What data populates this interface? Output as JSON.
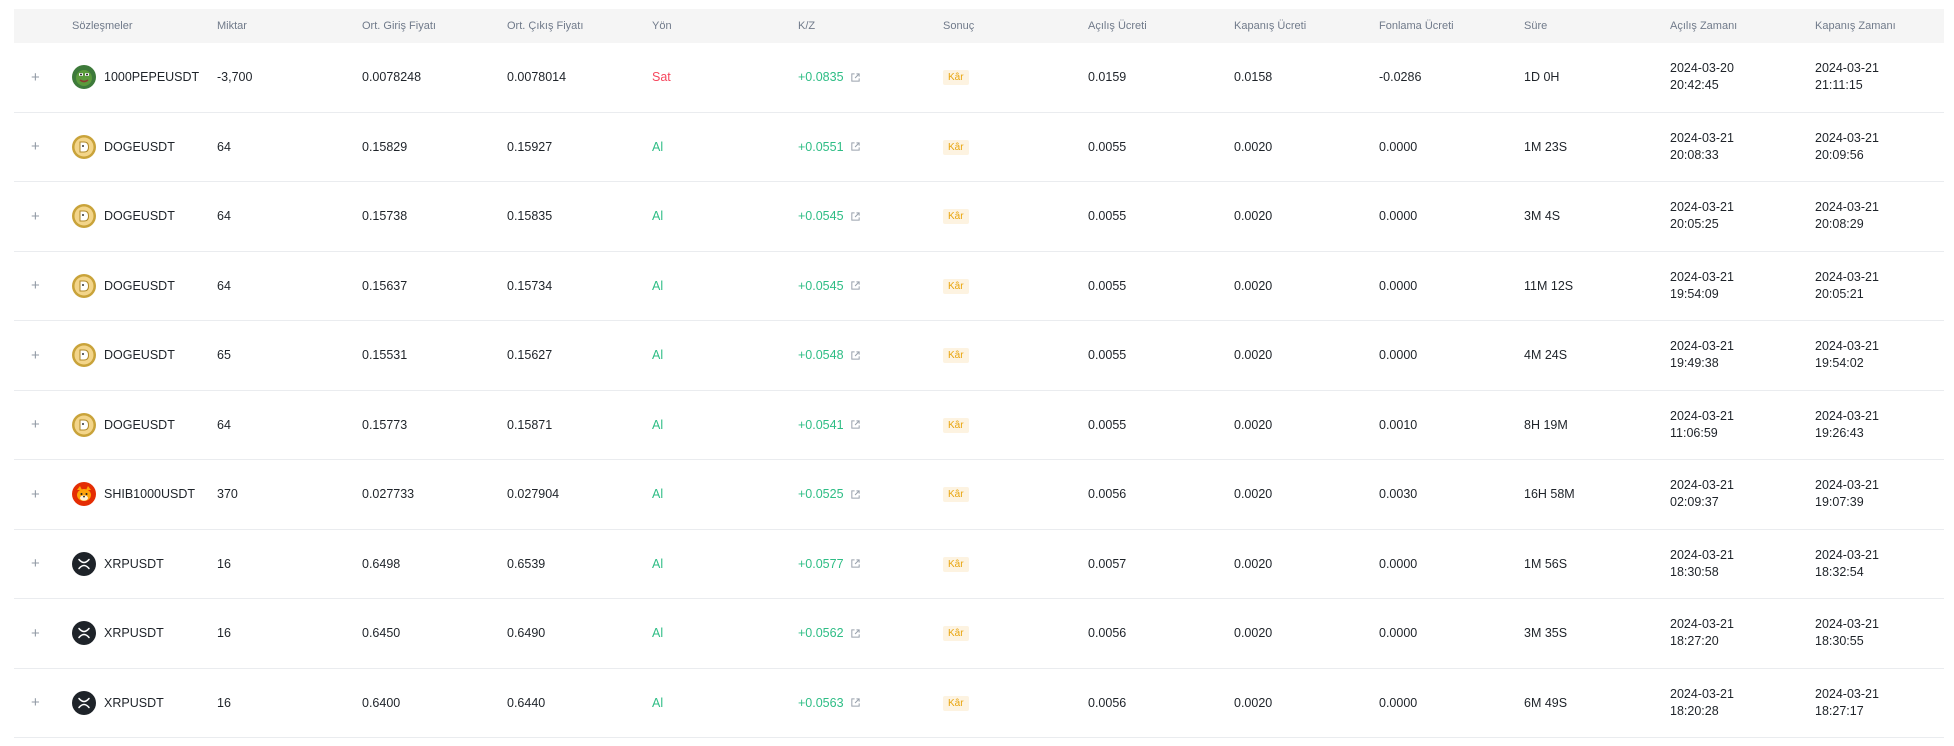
{
  "colors": {
    "sell": "#f6465d",
    "buy": "#2ebd85",
    "profit_badge_bg": "#fdf3e1",
    "profit_badge_text": "#e8a40c",
    "header_bg": "#f5f5f5"
  },
  "headers": {
    "contracts": "Sözleşmeler",
    "quantity": "Miktar",
    "avg_entry": "Ort. Giriş Fiyatı",
    "avg_exit": "Ort. Çıkış Fiyatı",
    "direction": "Yön",
    "pnl": "K/Z",
    "result": "Sonuç",
    "open_fee": "Açılış Ücreti",
    "close_fee": "Kapanış Ücreti",
    "funding_fee": "Fonlama Ücreti",
    "duration": "Süre",
    "open_time": "Açılış Zamanı",
    "close_time": "Kapanış Zamanı"
  },
  "rows": [
    {
      "expand": "+",
      "icon": "pepe-coin-icon",
      "symbol": "1000PEPEUSDT",
      "quantity": "-3,700",
      "entry": "0.0078248",
      "exit": "0.0078014",
      "side": "Sat",
      "side_type": "sell",
      "pnl": "+0.0835",
      "result": "Kâr",
      "open_fee": "0.0159",
      "close_fee": "0.0158",
      "funding_fee": "-0.0286",
      "duration": "1D 0H",
      "open_date": "2024-03-20",
      "open_clock": "20:42:45",
      "close_date": "2024-03-21",
      "close_clock": "21:11:15"
    },
    {
      "expand": "+",
      "icon": "doge-coin-icon",
      "symbol": "DOGEUSDT",
      "quantity": "64",
      "entry": "0.15829",
      "exit": "0.15927",
      "side": "Al",
      "side_type": "buy",
      "pnl": "+0.0551",
      "result": "Kâr",
      "open_fee": "0.0055",
      "close_fee": "0.0020",
      "funding_fee": "0.0000",
      "duration": "1M 23S",
      "open_date": "2024-03-21",
      "open_clock": "20:08:33",
      "close_date": "2024-03-21",
      "close_clock": "20:09:56"
    },
    {
      "expand": "+",
      "icon": "doge-coin-icon",
      "symbol": "DOGEUSDT",
      "quantity": "64",
      "entry": "0.15738",
      "exit": "0.15835",
      "side": "Al",
      "side_type": "buy",
      "pnl": "+0.0545",
      "result": "Kâr",
      "open_fee": "0.0055",
      "close_fee": "0.0020",
      "funding_fee": "0.0000",
      "duration": "3M 4S",
      "open_date": "2024-03-21",
      "open_clock": "20:05:25",
      "close_date": "2024-03-21",
      "close_clock": "20:08:29"
    },
    {
      "expand": "+",
      "icon": "doge-coin-icon",
      "symbol": "DOGEUSDT",
      "quantity": "64",
      "entry": "0.15637",
      "exit": "0.15734",
      "side": "Al",
      "side_type": "buy",
      "pnl": "+0.0545",
      "result": "Kâr",
      "open_fee": "0.0055",
      "close_fee": "0.0020",
      "funding_fee": "0.0000",
      "duration": "11M 12S",
      "open_date": "2024-03-21",
      "open_clock": "19:54:09",
      "close_date": "2024-03-21",
      "close_clock": "20:05:21"
    },
    {
      "expand": "+",
      "icon": "doge-coin-icon",
      "symbol": "DOGEUSDT",
      "quantity": "65",
      "entry": "0.15531",
      "exit": "0.15627",
      "side": "Al",
      "side_type": "buy",
      "pnl": "+0.0548",
      "result": "Kâr",
      "open_fee": "0.0055",
      "close_fee": "0.0020",
      "funding_fee": "0.0000",
      "duration": "4M 24S",
      "open_date": "2024-03-21",
      "open_clock": "19:49:38",
      "close_date": "2024-03-21",
      "close_clock": "19:54:02"
    },
    {
      "expand": "+",
      "icon": "doge-coin-icon",
      "symbol": "DOGEUSDT",
      "quantity": "64",
      "entry": "0.15773",
      "exit": "0.15871",
      "side": "Al",
      "side_type": "buy",
      "pnl": "+0.0541",
      "result": "Kâr",
      "open_fee": "0.0055",
      "close_fee": "0.0020",
      "funding_fee": "0.0010",
      "duration": "8H 19M",
      "open_date": "2024-03-21",
      "open_clock": "11:06:59",
      "close_date": "2024-03-21",
      "close_clock": "19:26:43"
    },
    {
      "expand": "+",
      "icon": "shib-coin-icon",
      "symbol": "SHIB1000USDT",
      "quantity": "370",
      "entry": "0.027733",
      "exit": "0.027904",
      "side": "Al",
      "side_type": "buy",
      "pnl": "+0.0525",
      "result": "Kâr",
      "open_fee": "0.0056",
      "close_fee": "0.0020",
      "funding_fee": "0.0030",
      "duration": "16H 58M",
      "open_date": "2024-03-21",
      "open_clock": "02:09:37",
      "close_date": "2024-03-21",
      "close_clock": "19:07:39"
    },
    {
      "expand": "+",
      "icon": "xrp-coin-icon",
      "symbol": "XRPUSDT",
      "quantity": "16",
      "entry": "0.6498",
      "exit": "0.6539",
      "side": "Al",
      "side_type": "buy",
      "pnl": "+0.0577",
      "result": "Kâr",
      "open_fee": "0.0057",
      "close_fee": "0.0020",
      "funding_fee": "0.0000",
      "duration": "1M 56S",
      "open_date": "2024-03-21",
      "open_clock": "18:30:58",
      "close_date": "2024-03-21",
      "close_clock": "18:32:54"
    },
    {
      "expand": "+",
      "icon": "xrp-coin-icon",
      "symbol": "XRPUSDT",
      "quantity": "16",
      "entry": "0.6450",
      "exit": "0.6490",
      "side": "Al",
      "side_type": "buy",
      "pnl": "+0.0562",
      "result": "Kâr",
      "open_fee": "0.0056",
      "close_fee": "0.0020",
      "funding_fee": "0.0000",
      "duration": "3M 35S",
      "open_date": "2024-03-21",
      "open_clock": "18:27:20",
      "close_date": "2024-03-21",
      "close_clock": "18:30:55"
    },
    {
      "expand": "+",
      "icon": "xrp-coin-icon",
      "symbol": "XRPUSDT",
      "quantity": "16",
      "entry": "0.6400",
      "exit": "0.6440",
      "side": "Al",
      "side_type": "buy",
      "pnl": "+0.0563",
      "result": "Kâr",
      "open_fee": "0.0056",
      "close_fee": "0.0020",
      "funding_fee": "0.0000",
      "duration": "6M 49S",
      "open_date": "2024-03-21",
      "open_clock": "18:20:28",
      "close_date": "2024-03-21",
      "close_clock": "18:27:17"
    }
  ]
}
